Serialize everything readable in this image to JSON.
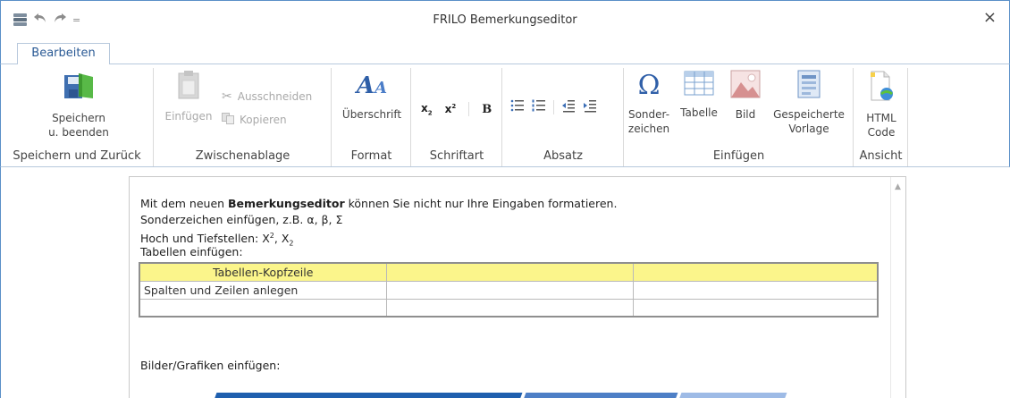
{
  "window": {
    "title": "FRILO Bemerkungseditor",
    "close_glyph": "×",
    "qat_customize": "="
  },
  "tabs": [
    {
      "label": "Bearbeiten"
    }
  ],
  "ribbon": {
    "groups": {
      "save": {
        "label": "Speichern und Zurück",
        "button_line1": "Speichern",
        "button_line2": "u. beenden"
      },
      "clipboard": {
        "label": "Zwischenablage",
        "paste": "Einfügen",
        "cut": "Ausschneiden",
        "copy": "Kopieren"
      },
      "format": {
        "label": "Format",
        "heading": "Überschrift"
      },
      "font": {
        "label": "Schriftart",
        "sub": "x",
        "sub_index": "2",
        "sup": "x",
        "sup_index": "2",
        "bold": "B"
      },
      "paragraph": {
        "label": "Absatz"
      },
      "insert": {
        "label": "Einfügen",
        "special_line1": "Sonder-",
        "special_line2": "zeichen",
        "table": "Tabelle",
        "image": "Bild",
        "template_line1": "Gespeicherte",
        "template_line2": "Vorlage"
      },
      "view": {
        "label": "Ansicht",
        "html_line1": "HTML",
        "html_line2": "Code"
      }
    }
  },
  "document": {
    "line1_pre": "Mit dem neuen ",
    "line1_bold": "Bemerkungseditor",
    "line1_post": " können Sie nicht nur Ihre Eingaben formatieren.",
    "line2": "Sonderzeichen einfügen, z.B. α, β, Σ",
    "line3_pre": "Hoch und Tiefstellen: X",
    "line3_sup": "2",
    "line3_mid": ", X",
    "line3_sub": "2",
    "line4": "Tabellen einfügen:",
    "table": {
      "header": "Tabellen-Kopfzeile",
      "row1": "Spalten und Zeilen anlegen"
    },
    "line5": "Bilder/Grafiken einfügen:"
  },
  "colors": {
    "accent": "#2a5a95",
    "table_header": "#fbf58b",
    "bar1": "#1f5fae",
    "bar2": "#4e7fc6",
    "bar3": "#9ebbe6"
  }
}
